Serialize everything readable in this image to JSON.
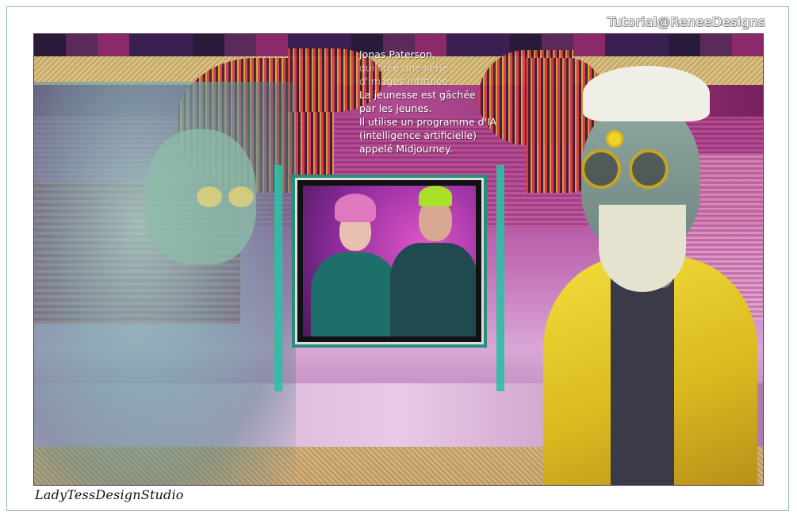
{
  "watermark": "Tutorial@ReneeDesigns",
  "poem": {
    "lines": [
      "Jonas Paterson,",
      "qui crée une série",
      "d'images intitulée :",
      "La jeunesse est gâchée",
      "par les jeunes.",
      "Il utilise un programme d'IA",
      "(intelligence artificielle)",
      "appelé Midjourney."
    ]
  },
  "signature": "LadyTessDesignStudio",
  "colors": {
    "teal_accent": "#2bc0a4",
    "magenta": "#a53a8e",
    "yellow_jacket": "#f2de3a"
  }
}
